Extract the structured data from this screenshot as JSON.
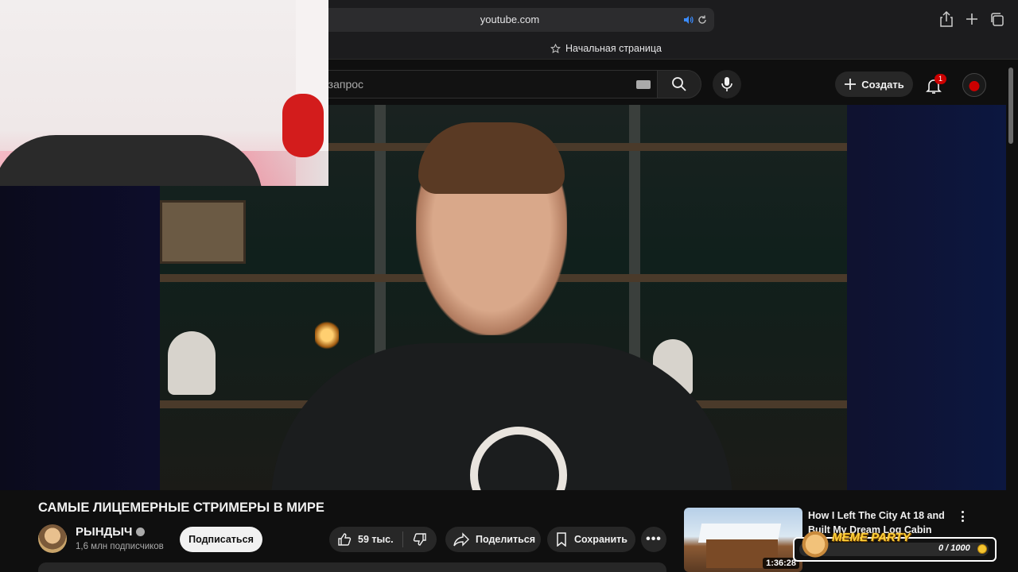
{
  "browser": {
    "url": "youtube.com",
    "favorites_item": "Начальная страница"
  },
  "header": {
    "search_placeholder": "е запрос",
    "create_label": "Создать",
    "notification_count": "1"
  },
  "video": {
    "title": "САМЫЕ ЛИЦЕМЕРНЫЕ СТРИМЕРЫ В МИРЕ"
  },
  "channel": {
    "name": "РЫНДЫЧ",
    "subscribers": "1,6 млн подписчиков",
    "subscribe_label": "Подписаться"
  },
  "actions": {
    "likes": "59 тыс.",
    "share_label": "Поделиться",
    "save_label": "Сохранить",
    "more_label": "•••"
  },
  "recommendation": {
    "title": "How I Left The City At 18 and Built My Dream Log Cabin",
    "duration": "1:36:28"
  },
  "overlay": {
    "title": "MEME PARTY",
    "progress": "0 / 1000",
    "progress_fraction": 0
  },
  "colors": {
    "background": "#0f0f0f",
    "surface": "#272727",
    "accent_red": "#cc0000",
    "meme_yellow": "#ffd23a"
  }
}
